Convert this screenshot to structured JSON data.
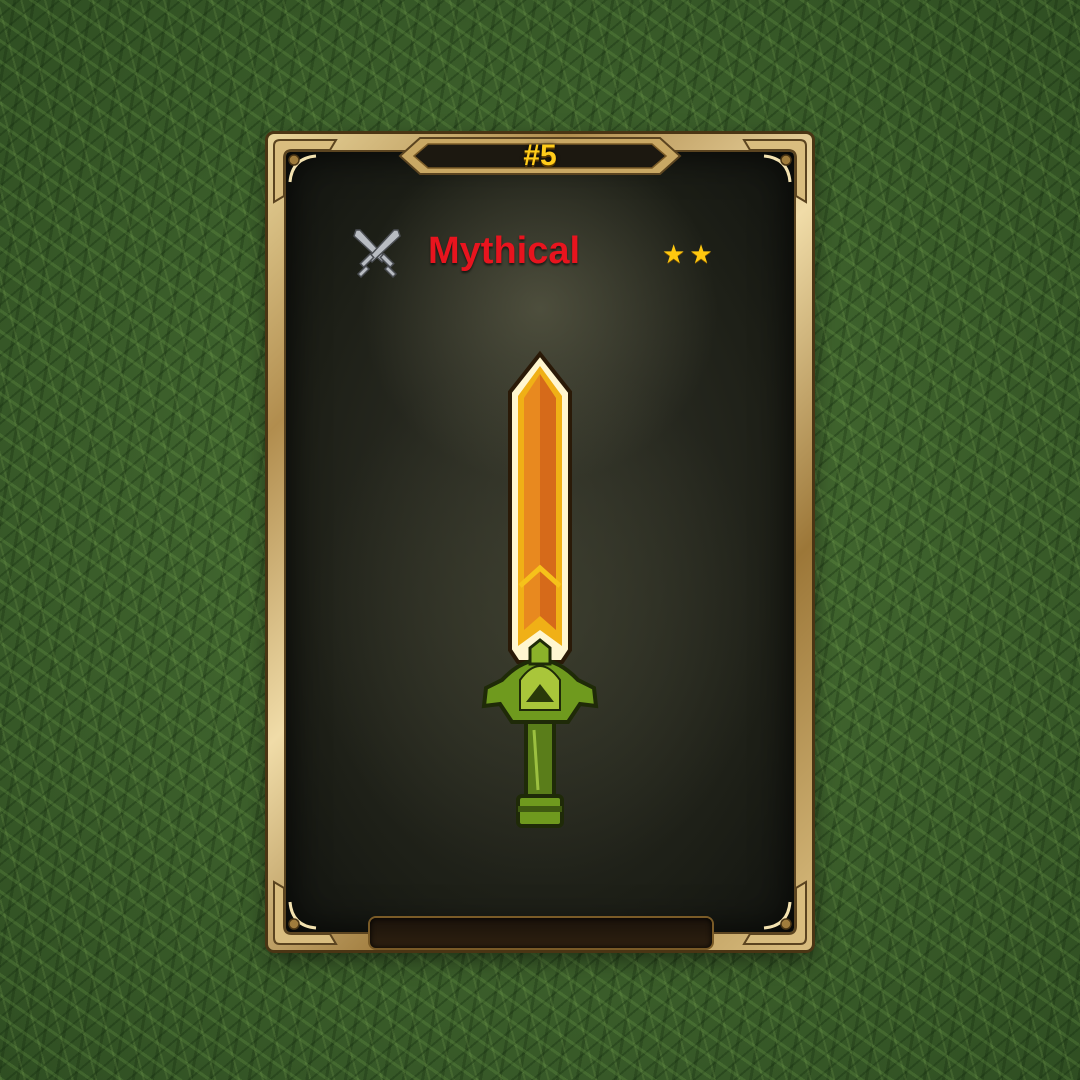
{
  "card": {
    "number": "#5",
    "rarity": "Mythical",
    "rarity_color": "#e8141e",
    "category_icon": "crossed-swords-icon",
    "stars": 2,
    "star_glyph": "★",
    "star_color": "#ffc80f",
    "item_icon": "sword-icon",
    "frame_color": "#c9a864",
    "number_color": "#ffcc1a"
  },
  "background": {
    "texture": "grass",
    "color": "#3b5e2a"
  }
}
